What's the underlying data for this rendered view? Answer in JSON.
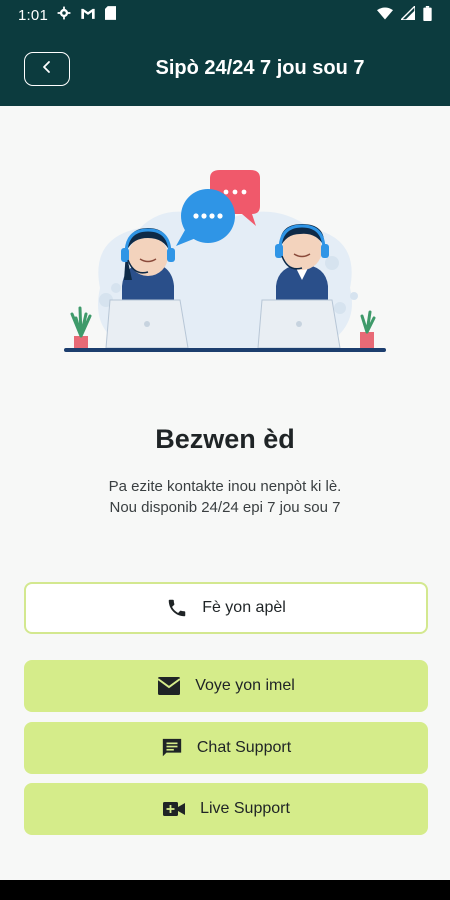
{
  "status": {
    "time": "1:01",
    "left_icons": [
      "gear-icon",
      "gmail-icon",
      "sim-icon"
    ],
    "right_icons": [
      "wifi-icon",
      "signal-icon",
      "battery-icon"
    ]
  },
  "appbar": {
    "title": "Sipò 24/24 7 jou sou 7",
    "back_icon": "chevron-left-icon"
  },
  "main": {
    "heading": "Bezwen èd",
    "subtext_line1": "Pa ezite kontakte inou nenpòt ki lè.",
    "subtext_line2": "Nou disponib 24/24 epi 7 jou sou 7"
  },
  "actions": {
    "call_label": "Fè yon apèl",
    "email_label": "Voye yon imel",
    "chat_label": "Chat Support",
    "live_label": "Live Support"
  },
  "colors": {
    "header_bg": "#0c3b3e",
    "button_fill": "#d5ec8a",
    "button_outline": "#d3e88f",
    "bubble_blue": "#2f95e6",
    "bubble_red": "#f0596b"
  }
}
